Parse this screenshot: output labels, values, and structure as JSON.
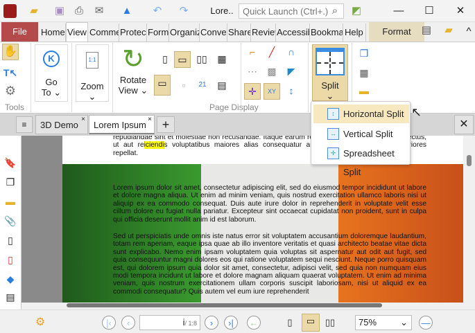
{
  "titlebar": {
    "doc_menu": "Lore..",
    "quick_launch_placeholder": "Quick Launch (Ctrl+.)",
    "minimize": "—",
    "maximize": "☐",
    "close": "✕"
  },
  "menu_tabs": [
    "File",
    "Home",
    "View",
    "Comme",
    "Protec",
    "Form",
    "Organiz",
    "Conver",
    "Share",
    "Review",
    "Accessib",
    "Bookma",
    "Help",
    "Format"
  ],
  "active_tab": "View",
  "ribbon": {
    "goto": [
      "Go",
      "To ⌄"
    ],
    "zoom": "Zoom",
    "rotate": [
      "Rotate",
      "View ⌄"
    ],
    "split": "Split",
    "groups": {
      "tools": "Tools",
      "page_display": "Page Display"
    }
  },
  "split_menu": {
    "items": [
      "Horizontal Split",
      "Vertical Split",
      "Spreadsheet Split"
    ],
    "highlighted": "Horizontal Split"
  },
  "doc_tabs": [
    {
      "label": "3D Demo",
      "active": false
    },
    {
      "label": "Lorem Ipsum",
      "active": true
    }
  ],
  "document": {
    "para0": "repudiandae sint et molestiae non recusandae. Itaque earum rerum hic tenetur a sapiente delectus, ut aut reiciendis voluptatibus maiores alias consequatur aut perferendis doloribus asperiores repellat.",
    "highlight_word": "iciendi",
    "para1": "Lorem ipsum dolor sit amet, consectetur adipiscing elit, sed do eiusmod tempor incididunt ut labore et dolore magna aliqua. Ut enim ad minim veniam, quis nostrud exercitation ullamco laboris nisi ut aliquip ex ea commodo consequat. Duis aute irure dolor in reprehenderit in voluptate velit esse cillum dolore eu fugiat nulla pariatur. Excepteur sint occaecat cupidatat non proident, sunt in culpa qui officia deserunt mollit anim id est laborum.",
    "para2": "Sed ut perspiciatis unde omnis iste natus error sit voluptatem accusantium doloremque laudantium, totam rem aperiam, eaque ipsa quae ab illo inventore veritatis et quasi architecto beatae vitae dicta sunt explicabo. Nemo enim ipsam voluptatem quia voluptas sit aspernatur aut odit aut fugit, sed quia consequuntur magni dolores eos qui ratione voluptatem sequi nesciunt. Neque porro quisquam est, qui dolorem ipsum quia dolor sit amet, consectetur, adipisci velit, sed quia non numquam eius modi tempora incidunt ut labore et dolore magnam aliquam quaerat voluptatem. Ut enim ad minima veniam, quis nostrum exercitationem ullam corporis suscipit laboriosam, nisi ut aliquid ex ea commodi consequatur? Quis autem vel eum iure reprehenderit"
  },
  "statusbar": {
    "page_input": "i",
    "page_total": "/ 1:8",
    "zoom": "75%"
  },
  "colors": {
    "file_tab": "#b54a4a",
    "selected": "#ecd9a8",
    "flag_green": "#2f8a2a",
    "flag_orange": "#e0681c",
    "accent": "#2a7de1"
  }
}
